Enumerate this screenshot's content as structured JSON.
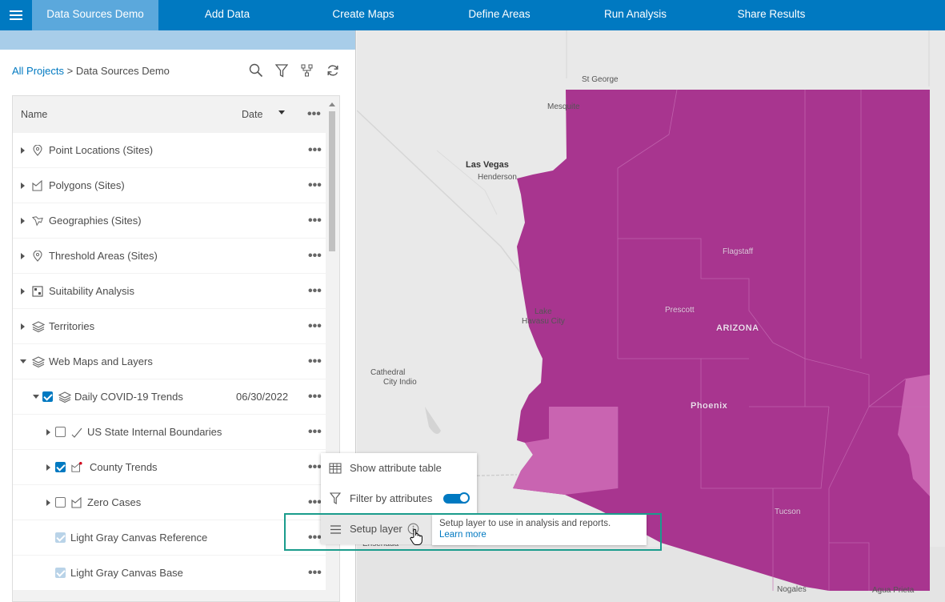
{
  "topnav": {
    "tabs": [
      {
        "label": "Data Sources Demo",
        "active": true
      },
      {
        "label": "Add Data"
      },
      {
        "label": "Create Maps"
      },
      {
        "label": "Define Areas"
      },
      {
        "label": "Run Analysis"
      },
      {
        "label": "Share Results"
      }
    ]
  },
  "breadcrumb": {
    "root": "All Projects",
    "separator": " > ",
    "current": "Data Sources Demo"
  },
  "toolbar": {
    "icons": [
      "search-icon",
      "filter-icon",
      "hierarchy-icon",
      "refresh-icon"
    ]
  },
  "list": {
    "headers": {
      "name": "Name",
      "date": "Date",
      "more": "•••"
    },
    "more_glyph": "•••",
    "rows": [
      {
        "label": "Point Locations (Sites)",
        "icon": "pin-icon"
      },
      {
        "label": "Polygons (Sites)",
        "icon": "polygon-icon"
      },
      {
        "label": "Geographies (Sites)",
        "icon": "geography-icon"
      },
      {
        "label": "Threshold Areas (Sites)",
        "icon": "pin-icon"
      },
      {
        "label": "Suitability Analysis",
        "icon": "suitability-icon"
      },
      {
        "label": "Territories",
        "icon": "layers-icon"
      },
      {
        "label": "Web Maps and Layers",
        "icon": "layers-icon",
        "expanded": true
      },
      {
        "label": "Daily COVID-19 Trends",
        "icon": "layers-icon",
        "date": "06/30/2022",
        "checked": true,
        "expanded": true
      },
      {
        "label": "US State Internal Boundaries",
        "icon": "line-icon",
        "checked": false
      },
      {
        "label": "County Trends",
        "icon": "polygon-icon",
        "checked": true
      },
      {
        "label": "Zero Cases",
        "icon": "polygon-icon",
        "checked": false
      },
      {
        "label": "Light Gray Canvas Reference",
        "checked": true,
        "disabled": true
      },
      {
        "label": "Light Gray Canvas Base",
        "checked": true,
        "disabled": true
      }
    ]
  },
  "context_menu": {
    "items": [
      {
        "label": "Show attribute table",
        "icon": "table-icon"
      },
      {
        "label": "Filter by attributes",
        "icon": "filter-icon",
        "toggle_on": true
      },
      {
        "label": "Setup layer",
        "icon": "menu-lines-icon"
      }
    ]
  },
  "tooltip": {
    "text": "Setup layer to use in analysis and reports.",
    "link": "Learn more"
  },
  "map": {
    "labels": {
      "st_george": "St George",
      "mesquite": "Mesquite",
      "las_vegas": "Las Vegas",
      "henderson": "Henderson",
      "flagstaff": "Flagstaff",
      "prescott": "Prescott",
      "arizona": "ARIZONA",
      "lake_havasu_1": "Lake",
      "lake_havasu_2": "Havasu City",
      "cathedral_1": "Cathedral",
      "cathedral_2": "City Indio",
      "phoenix": "Phoenix",
      "tucson": "Tucson",
      "ensenada": "Ensenada",
      "nogales": "Nogales",
      "agua_prieta": "Agua Prieta"
    },
    "colors": {
      "dark": "#a8358f",
      "light": "#c964b1",
      "base": "#e9e9e9"
    }
  }
}
